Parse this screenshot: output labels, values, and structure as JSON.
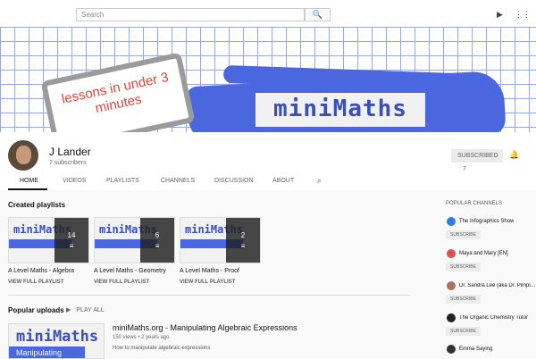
{
  "header": {
    "search_placeholder": "Search",
    "search_icon_glyph": "🔍",
    "video_icon_glyph": "▶",
    "apps_icon_glyph": "⋮⋮"
  },
  "banner": {
    "tagline": "lessons in under 3 minutes",
    "logo_text": "miniMaths",
    "accent_color": "#4a67e0",
    "tagline_color": "#e0443c"
  },
  "channel": {
    "name": "J Lander",
    "subscribers": "7 subscribers",
    "subscribe_label": "SUBSCRIBED",
    "subscribe_count": "7"
  },
  "tabs": [
    "HOME",
    "VIDEOS",
    "PLAYLISTS",
    "CHANNELS",
    "DISCUSSION",
    "ABOUT"
  ],
  "created_playlists": {
    "heading": "Created playlists",
    "items": [
      {
        "logo": "miniMaths",
        "count": "14",
        "title": "A Level Maths - Algebra",
        "link": "VIEW FULL PLAYLIST"
      },
      {
        "logo": "miniMaths",
        "count": "6",
        "title": "A Level Maths - Geometry",
        "link": "VIEW FULL PLAYLIST"
      },
      {
        "logo": "miniMaths",
        "count": "2",
        "title": "A Level Maths - Proof",
        "link": "VIEW FULL PLAYLIST"
      }
    ]
  },
  "popular_uploads": {
    "heading": "Popular uploads",
    "play_all": "PLAY ALL",
    "video": {
      "thumb_logo": "miniMaths",
      "thumb_caption": "Manipulating",
      "title": "miniMaths.org - Manipulating Algebraic Expressions",
      "meta": "150 views • 2 years ago",
      "description": "How to manipulate algebraic expressions"
    }
  },
  "popular_channels": {
    "heading": "POPULAR CHANNELS",
    "subscribe_label": "SUBSCRIBE",
    "items": [
      {
        "name": "The Infographics Show",
        "color": "#2f7de1"
      },
      {
        "name": "Maya and Mary [EN]",
        "color": "#d9534f"
      },
      {
        "name": "Dr. Sandra Lee (aka Dr. Pimple Popper)",
        "color": "#b07060"
      },
      {
        "name": "The Organic Chemistry Tutor",
        "color": "#222222"
      },
      {
        "name": "Emma Saying",
        "color": "#333333"
      }
    ]
  }
}
